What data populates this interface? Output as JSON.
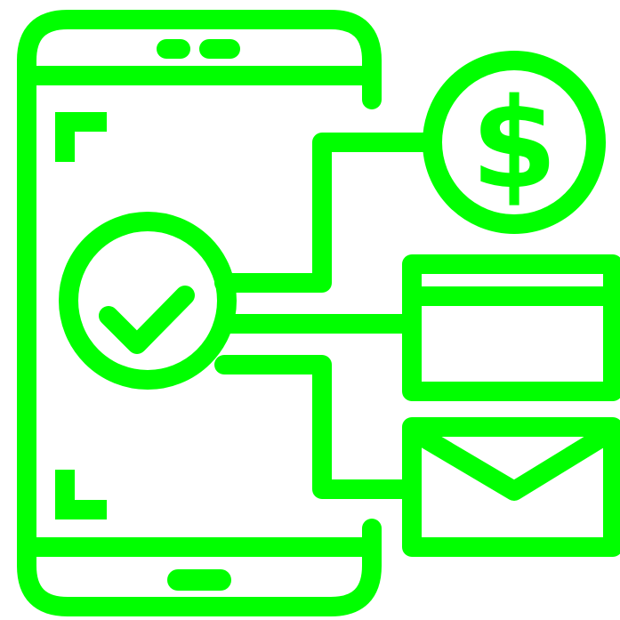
{
  "icon": {
    "name": "mobile-payment-icon",
    "color": "#00ff00",
    "background": "#ffffff",
    "parts": {
      "phone": "smartphone-icon",
      "check": "check-circle-icon",
      "dollar": "dollar-coin-icon",
      "card": "credit-card-icon",
      "mail": "envelope-icon"
    }
  }
}
